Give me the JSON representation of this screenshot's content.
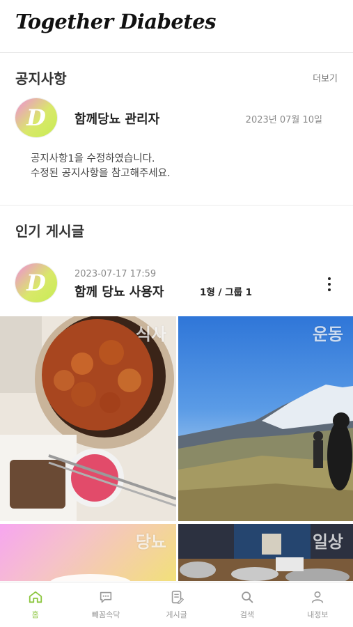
{
  "header": {
    "app_title": "Together Diabetes"
  },
  "notice": {
    "section_title": "공지사항",
    "more_label": "더보기",
    "avatar_letter": "D",
    "author": "함께당뇨 관리자",
    "date": "2023년 07월 10일",
    "body_line1": "공지사항1을 수정하였습니다.",
    "body_line2": "수정된 공지사항을 참고해주세요."
  },
  "popular": {
    "section_title": "인기 게시글",
    "post": {
      "avatar_letter": "D",
      "timestamp": "2023-07-17 17:59",
      "author": "함께 당뇨 사용자",
      "group": "1형 / 그룹 1"
    },
    "tiles": [
      {
        "label": "식사"
      },
      {
        "label": "운동"
      },
      {
        "label": "당뇨"
      },
      {
        "label": "일상"
      }
    ]
  },
  "bottom_nav": {
    "items": [
      {
        "label": "홈",
        "icon": "home-icon",
        "active": true
      },
      {
        "label": "뺴꼼속닥",
        "icon": "chat-icon",
        "active": false
      },
      {
        "label": "게시글",
        "icon": "post-icon",
        "active": false
      },
      {
        "label": "검색",
        "icon": "search-icon",
        "active": false
      },
      {
        "label": "내정보",
        "icon": "user-icon",
        "active": false
      }
    ]
  },
  "colors": {
    "accent": "#8cc63f",
    "inactive": "#9a9a9a"
  }
}
